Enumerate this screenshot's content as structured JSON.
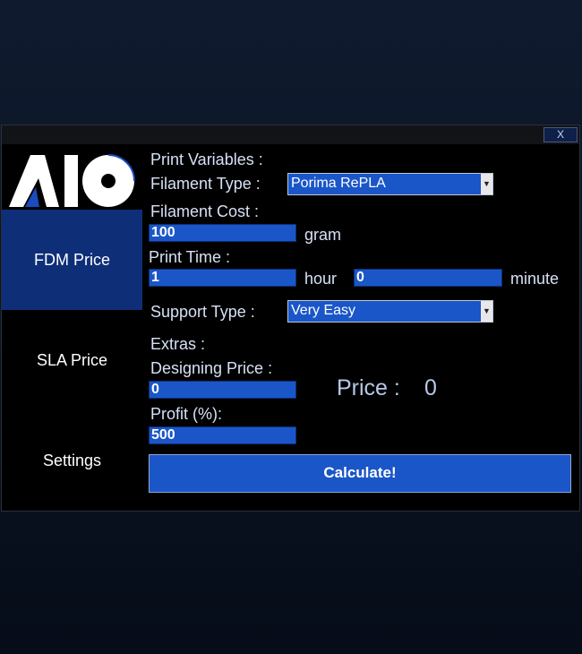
{
  "window": {
    "close_label": "X"
  },
  "logo": {
    "text": "AIO"
  },
  "sidebar": {
    "items": [
      {
        "label": "FDM Price"
      },
      {
        "label": "SLA Price"
      },
      {
        "label": "Settings"
      }
    ]
  },
  "form": {
    "print_variables_label": "Print Variables :",
    "filament_type_label": "Filament Type :",
    "filament_type_value": "Porima RePLA",
    "filament_cost_label": "Filament Cost :",
    "filament_cost_value": "100",
    "filament_cost_unit": "gram",
    "print_time_label": "Print Time :",
    "print_time_hours": "1",
    "hour_unit": "hour",
    "print_time_minutes": "0",
    "minute_unit": "minute",
    "support_type_label": "Support Type :",
    "support_type_value": "Very Easy",
    "extras_label": "Extras :",
    "designing_price_label": "Designing Price :",
    "designing_price_value": "0",
    "profit_label": "Profit (%):",
    "profit_value": "500"
  },
  "result": {
    "price_label": "Price :",
    "price_value": "0"
  },
  "actions": {
    "calculate_label": "Calculate!"
  },
  "colors": {
    "accent": "#1a56c8",
    "nav_active": "#0e2f78",
    "label": "#d6e0f5"
  }
}
